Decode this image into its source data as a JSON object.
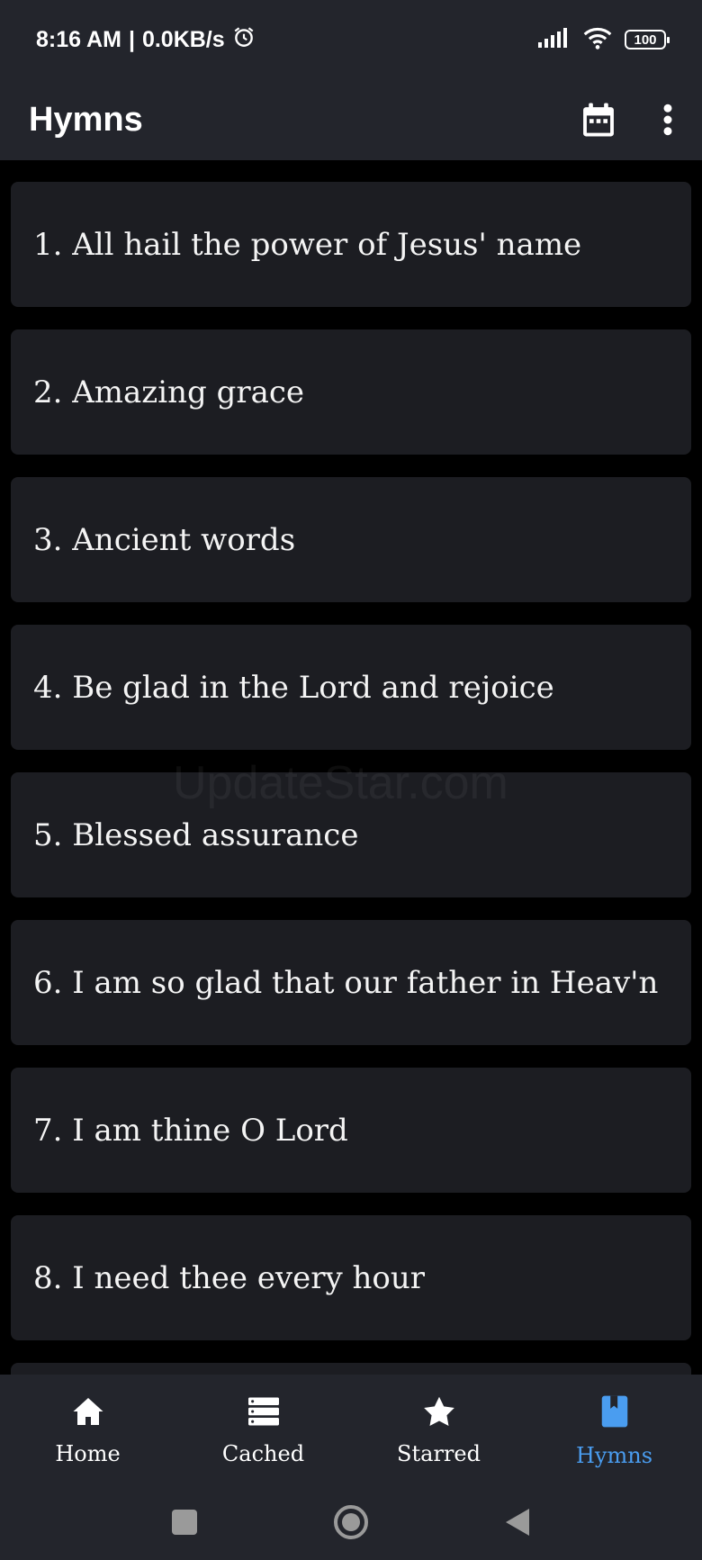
{
  "status_bar": {
    "time": "8:16 AM",
    "network_speed": "0.0KB/s",
    "battery": "100",
    "icons": [
      "alarm-icon",
      "signal-icon",
      "wifi-icon",
      "battery-icon"
    ]
  },
  "app_bar": {
    "title": "Hymns",
    "actions": [
      "calendar-icon",
      "more-vert-icon"
    ]
  },
  "hymns": [
    {
      "label": "1. All hail the power of Jesus' name"
    },
    {
      "label": "2. Amazing grace"
    },
    {
      "label": "3. Ancient words"
    },
    {
      "label": "4. Be glad in the Lord and rejoice"
    },
    {
      "label": "5. Blessed assurance"
    },
    {
      "label": "6. I am so glad that our father in Heav'n"
    },
    {
      "label": "7. I am thine O Lord"
    },
    {
      "label": "8. I need thee every hour"
    }
  ],
  "watermark": "UpdateStar.com",
  "bottom_nav": {
    "items": [
      {
        "label": "Home",
        "icon": "home-icon"
      },
      {
        "label": "Cached",
        "icon": "list-icon"
      },
      {
        "label": "Starred",
        "icon": "star-icon"
      },
      {
        "label": "Hymns",
        "icon": "book-icon",
        "active": true
      }
    ]
  },
  "colors": {
    "background": "#000000",
    "surface": "#23252c",
    "card": "#1c1d22",
    "accent": "#4a9df0"
  }
}
